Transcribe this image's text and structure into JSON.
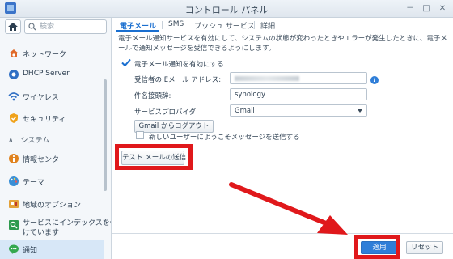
{
  "window": {
    "title": "コントロール パネル",
    "minimize": "－",
    "maximize": "□",
    "close": "✕"
  },
  "sidebar": {
    "search_placeholder": "検索",
    "items_top": [
      {
        "label": "ネットワーク",
        "icon": "house-network-icon"
      },
      {
        "label": "DHCP Server",
        "icon": "dhcp-icon"
      },
      {
        "label": "ワイヤレス",
        "icon": "wifi-icon"
      },
      {
        "label": "セキュリティ",
        "icon": "shield-icon"
      }
    ],
    "section_label": "システム",
    "items_system": [
      {
        "label": "情報センター",
        "icon": "info-center-icon"
      },
      {
        "label": "テーマ",
        "icon": "palette-icon"
      },
      {
        "label": "地域のオプション",
        "icon": "region-icon"
      },
      {
        "label_line1": "サービスにインデックスを付",
        "label_line2": "けています",
        "icon": "index-icon"
      },
      {
        "label": "通知",
        "icon": "chat-bubble-icon",
        "active": true
      }
    ]
  },
  "tabs": [
    {
      "label": "電子メール",
      "active": true
    },
    {
      "label": "SMS"
    },
    {
      "label": "プッシュ サービス"
    },
    {
      "label": "詳細"
    }
  ],
  "email": {
    "description": "電子メール通知サービスを有効にして、システムの状態が変わったときやエラーが発生したときに、電子メールで通知メッセージを受信できるようにします。",
    "enable_label": "電子メール通知を有効にする",
    "recipient_label": "受信者の Eメール アドレス:",
    "subject_prefix_label": "件名接頭辞:",
    "subject_prefix_value": "synology",
    "provider_label": "サービスプロバイダ:",
    "provider_value": "Gmail",
    "logout_button": "Gmail からログアウト",
    "welcome_label": "新しいユーザーにようこそメッセージを送信する",
    "test_button": "テスト メールの送信"
  },
  "footer": {
    "apply_button": "適用",
    "reset_button": "リセット"
  },
  "colors": {
    "accent": "#1a6fd0",
    "highlight": "#e0181b"
  }
}
